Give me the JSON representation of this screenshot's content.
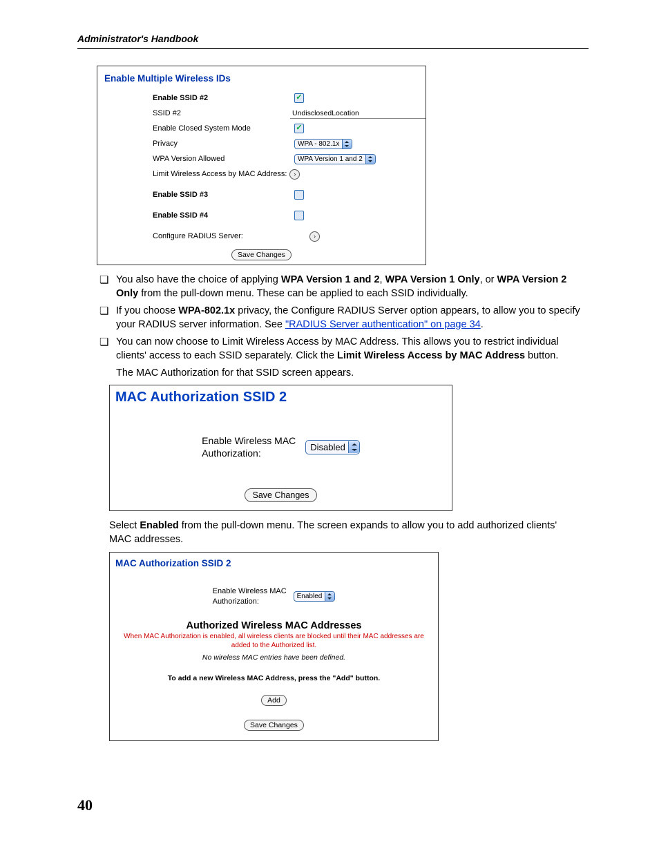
{
  "page": {
    "running_head": "Administrator's Handbook",
    "number": "40"
  },
  "panel1": {
    "title": "Enable Multiple Wireless IDs",
    "rows": {
      "enable_ssid2": "Enable SSID #2",
      "ssid2": "SSID #2",
      "ssid2_value": "UndisclosedLocation",
      "closed_mode": "Enable Closed System Mode",
      "privacy": "Privacy",
      "privacy_value": "WPA - 802.1x",
      "wpa_allowed": "WPA Version Allowed",
      "wpa_allowed_value": "WPA Version 1 and 2",
      "limit_mac": "Limit Wireless Access by MAC Address:",
      "enable_ssid3": "Enable SSID #3",
      "enable_ssid4": "Enable SSID #4",
      "configure_radius": "Configure RADIUS Server:"
    },
    "save": "Save Changes"
  },
  "body": {
    "li1_a": "You also have the choice of applying ",
    "li1_b1": "WPA Version 1 and 2",
    "li1_c": ", ",
    "li1_b2": "WPA Version 1 Only",
    "li1_d": ", or ",
    "li1_b3": "WPA Version 2 Only",
    "li1_e": " from the pull-down menu. These can be applied to each SSID individually.",
    "li2_a": "If you choose ",
    "li2_b": "WPA-802.1x",
    "li2_c": " privacy, the Configure RADIUS Server option appears, to allow you to specify your RADIUS server information. See ",
    "li2_link": "\"RADIUS Server authentication\" on page 34",
    "li2_d": ".",
    "li3_a": "You can now choose to Limit Wireless Access by MAC Address. This allows you to restrict individual clients' access to each SSID separately. Click the ",
    "li3_b": "Limit Wireless Access by MAC Address",
    "li3_c": " button.",
    "after1": "The MAC Authorization for that SSID screen appears.",
    "mid_a": "Select ",
    "mid_b": "Enabled",
    "mid_c": " from the pull-down menu. The screen expands to allow you to add authorized clients' MAC addresses."
  },
  "panel2": {
    "title": "MAC Authorization SSID 2",
    "label": "Enable Wireless MAC Authorization:",
    "value": "Disabled",
    "save": "Save Changes"
  },
  "panel3": {
    "title": "MAC Authorization SSID 2",
    "label": "Enable Wireless MAC Authorization:",
    "value": "Enabled",
    "heading": "Authorized Wireless MAC Addresses",
    "warn": "When MAC Authorization is enabled, all wireless clients are blocked until their MAC addresses are added to the Authorized list.",
    "italic": "No wireless MAC entries have been defined.",
    "bold": "To add a new Wireless MAC Address, press the \"Add\" button.",
    "add": "Add",
    "save": "Save Changes"
  }
}
